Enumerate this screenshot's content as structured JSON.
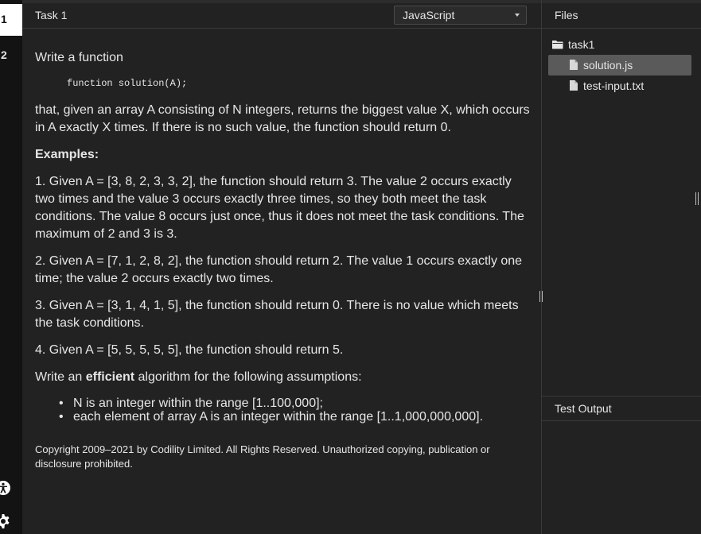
{
  "rail": {
    "tabs": [
      "1",
      "2"
    ]
  },
  "header": {
    "task_title": "Task 1",
    "language": "JavaScript"
  },
  "task": {
    "intro": "Write a function",
    "signature": "function solution(A);",
    "statement": "that, given an array A consisting of N integers, returns the biggest value X, which occurs in A exactly X times. If there is no such value, the function should return 0.",
    "examples_heading": "Examples:",
    "examples": [
      "1. Given A = [3, 8, 2, 3, 3, 2], the function should return 3. The value 2 occurs exactly two times and the value 3 occurs exactly three times, so they both meet the task conditions. The value 8 occurs just once, thus it does not meet the task conditions. The maximum of 2 and 3 is 3.",
      "2. Given A = [7, 1, 2, 8, 2], the function should return 2. The value 1 occurs exactly one time; the value 2 occurs exactly two times.",
      "3. Given A = [3, 1, 4, 1, 5], the function should return 0. There is no value which meets the task conditions.",
      "4. Given A = [5, 5, 5, 5, 5], the function should return 5."
    ],
    "assume_prefix": "Write an ",
    "assume_bold": "efficient",
    "assume_suffix": " algorithm for the following assumptions:",
    "assumptions": [
      "N is an integer within the range [1..100,000];",
      "each element of array A is an integer within the range [1..1,000,000,000]."
    ],
    "copyright": "Copyright 2009–2021 by Codility Limited. All Rights Reserved. Unauthorized copying, publication or disclosure prohibited."
  },
  "files": {
    "title": "Files",
    "folder": "task1",
    "items": [
      {
        "name": "solution.js",
        "selected": true
      },
      {
        "name": "test-input.txt",
        "selected": false
      }
    ]
  },
  "output": {
    "title": "Test Output"
  },
  "icons": {
    "accessibility": "accessibility-icon",
    "settings": "gear-icon",
    "folder": "folder-icon",
    "file": "file-icon"
  },
  "colors": {
    "background": "#222222",
    "rail": "#131313",
    "selected_file": "#5a5a5a",
    "active_tab": "#ffffff"
  }
}
